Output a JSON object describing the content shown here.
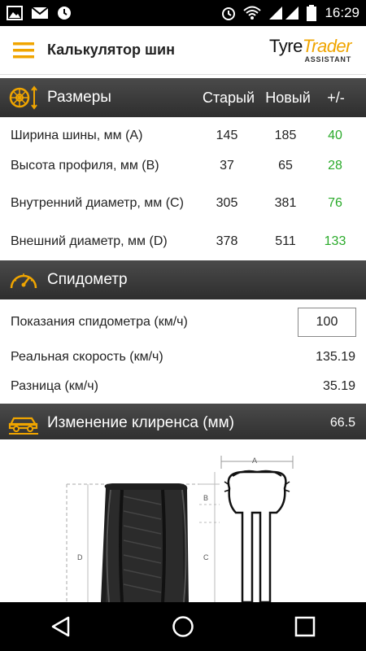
{
  "status_bar": {
    "time": "16:29",
    "icons": [
      "image-icon",
      "mail-icon",
      "sync-icon",
      "alarm-icon",
      "wifi-icon",
      "signal-icon",
      "battery-icon"
    ]
  },
  "app_bar": {
    "title": "Калькулятор шин",
    "logo_tyre": "Tyre",
    "logo_trader": "Trader",
    "logo_sub": "ASSISTANT"
  },
  "sizes": {
    "title": "Размеры",
    "col_old": "Старый",
    "col_new": "Новый",
    "col_diff": "+/-",
    "rows": [
      {
        "label": "Ширина шины, мм (A)",
        "old": "145",
        "new": "185",
        "diff": "40"
      },
      {
        "label": "Высота профиля, мм (B)",
        "old": "37",
        "new": "65",
        "diff": "28"
      },
      {
        "label": "Внутренний диаметр, мм (C)",
        "old": "305",
        "new": "381",
        "diff": "76"
      },
      {
        "label": "Внешний диаметр, мм (D)",
        "old": "378",
        "new": "511",
        "diff": "133"
      }
    ]
  },
  "speedometer": {
    "title": "Спидометр",
    "reading_label": "Показания спидометра (км/ч)",
    "reading_value": "100",
    "real_label": "Реальная скорость (км/ч)",
    "real_value": "135.19",
    "diff_label": "Разница (км/ч)",
    "diff_value": "35.19"
  },
  "clearance": {
    "title": "Изменение клиренса (мм)",
    "value": "66.5"
  },
  "diagram": {
    "label_a": "A",
    "label_b": "B",
    "label_c": "C",
    "label_d": "D"
  },
  "colors": {
    "accent": "#f0a500",
    "diff_green": "#2aaa2a",
    "header_dark": "#3a3a3a"
  }
}
